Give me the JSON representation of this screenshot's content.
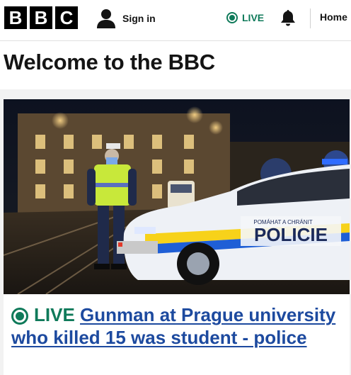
{
  "header": {
    "logo_letters": [
      "B",
      "B",
      "C"
    ],
    "signin_label": "Sign in",
    "live_label": "LIVE",
    "home_label": "Home"
  },
  "page_title": "Welcome to the BBC",
  "story": {
    "live_label": "LIVE",
    "headline": "Gunman at Prague university who killed 15 was student - police",
    "image_text": {
      "car_label": "POLICIE",
      "car_sublabel": "POMÁHAT A CHRÁNIT"
    }
  },
  "colors": {
    "live_green": "#0f7a5a",
    "link_blue": "#1d4a9f",
    "brand_black": "#000000"
  }
}
